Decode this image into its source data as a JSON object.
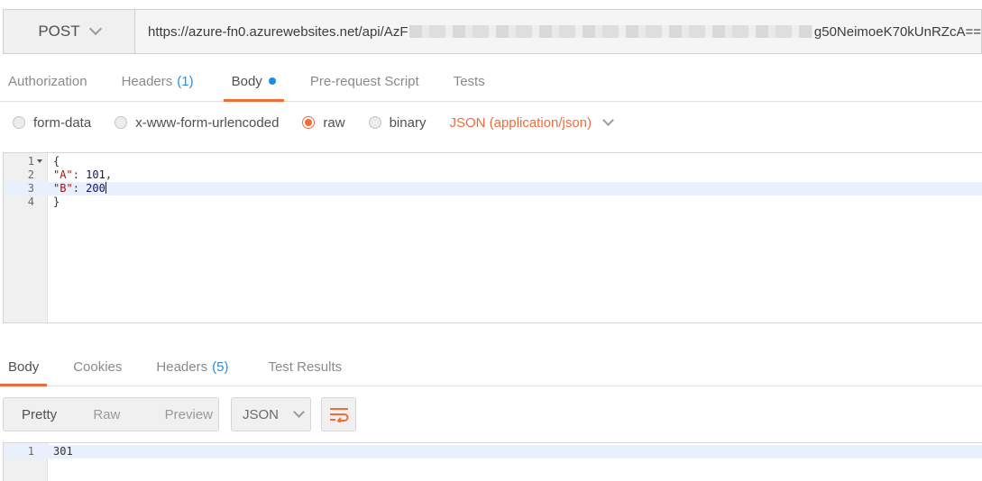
{
  "request": {
    "method": "POST",
    "url_prefix": "https://azure-fn0.azurewebsites.net/api/AzF",
    "url_suffix": "g50NeimoeK70kUnRZcA=="
  },
  "request_tabs": [
    {
      "label": "Authorization"
    },
    {
      "label": "Headers",
      "count": "(1)"
    },
    {
      "label": "Body",
      "active": true
    },
    {
      "label": "Pre-request Script"
    },
    {
      "label": "Tests"
    }
  ],
  "body_types": {
    "form_data": "form-data",
    "urlencoded": "x-www-form-urlencoded",
    "raw": "raw",
    "binary": "binary",
    "selected": "raw",
    "content_type": "JSON (application/json)"
  },
  "request_body_lines": [
    {
      "num": "1",
      "text": "{"
    },
    {
      "num": "2",
      "key": "\"A\"",
      "sep": ": ",
      "value": "101",
      "trail": ","
    },
    {
      "num": "3",
      "key": "\"B\"",
      "sep": ": ",
      "value": "200",
      "trail": ""
    },
    {
      "num": "4",
      "text": "}"
    }
  ],
  "response_tabs": [
    {
      "label": "Body",
      "active": true
    },
    {
      "label": "Cookies"
    },
    {
      "label": "Headers",
      "count": "(5)"
    },
    {
      "label": "Test Results"
    }
  ],
  "response_view": {
    "modes": [
      "Pretty",
      "Raw",
      "Preview"
    ],
    "active_mode": "Pretty",
    "format": "JSON"
  },
  "response_body_lines": [
    {
      "num": "1",
      "value": "301"
    }
  ],
  "colors": {
    "accent": "#f26b3a",
    "dot": "#1a8ce8",
    "count": "#2a8ee0"
  }
}
